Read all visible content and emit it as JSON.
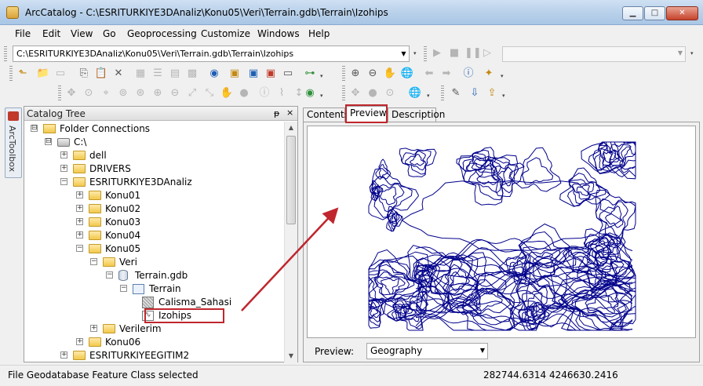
{
  "window": {
    "title": "ArcCatalog - C:\\ESRITURKIYE3DAnaliz\\Konu05\\Veri\\Terrain.gdb\\Terrain\\Izohips"
  },
  "menu": [
    "File",
    "Edit",
    "View",
    "Go",
    "Geoprocessing",
    "Customize",
    "Windows",
    "Help"
  ],
  "location": {
    "path": "C:\\ESRITURKIYE3DAnaliz\\Konu05\\Veri\\Terrain.gdb\\Terrain\\Izohips"
  },
  "arctoolbox": {
    "label": "ArcToolbox"
  },
  "catalog": {
    "title": "Catalog Tree",
    "pin_symbol": "ᵽ",
    "close_symbol": "×",
    "items": [
      {
        "label": "Folder Connections",
        "expander": "⊟",
        "icon": "folder-connections-icon"
      },
      {
        "label": "C:\\",
        "expander": "⊟",
        "icon": "drive-icon"
      },
      {
        "label": "dell",
        "expander": "+",
        "icon": "folder-icon"
      },
      {
        "label": "DRIVERS",
        "expander": "+",
        "icon": "folder-icon"
      },
      {
        "label": "ESRITURKIYE3DAnaliz",
        "expander": "−",
        "icon": "folder-icon"
      },
      {
        "label": "Konu01",
        "expander": "+",
        "icon": "folder-icon"
      },
      {
        "label": "Konu02",
        "expander": "+",
        "icon": "folder-icon"
      },
      {
        "label": "Konu03",
        "expander": "+",
        "icon": "folder-icon"
      },
      {
        "label": "Konu04",
        "expander": "+",
        "icon": "folder-icon"
      },
      {
        "label": "Konu05",
        "expander": "−",
        "icon": "folder-icon"
      },
      {
        "label": "Veri",
        "expander": "−",
        "icon": "folder-icon"
      },
      {
        "label": "Terrain.gdb",
        "expander": "−",
        "icon": "geodatabase-icon"
      },
      {
        "label": "Terrain",
        "expander": "−",
        "icon": "feature-dataset-icon"
      },
      {
        "label": "Calisma_Sahasi",
        "expander": "",
        "icon": "polygon-feature-class-icon"
      },
      {
        "label": "Izohips",
        "expander": "",
        "icon": "line-feature-class-icon",
        "selected": true
      },
      {
        "label": "Verilerim",
        "expander": "+",
        "icon": "folder-icon"
      },
      {
        "label": "Konu06",
        "expander": "+",
        "icon": "folder-icon"
      },
      {
        "label": "ESRITURKIYEEGITIM2",
        "expander": "+",
        "icon": "folder-icon"
      }
    ]
  },
  "tabs": [
    {
      "label": "Contents",
      "active": false
    },
    {
      "label": "Preview",
      "active": true
    },
    {
      "label": "Description",
      "active": false
    }
  ],
  "preview": {
    "label": "Preview:",
    "mode": "Geography"
  },
  "status": {
    "text": "File Geodatabase Feature Class selected",
    "coordinates": "282744.6314  4246630.2416"
  },
  "colors": {
    "contour_line": "#00008b",
    "highlight": "#c0262d"
  }
}
